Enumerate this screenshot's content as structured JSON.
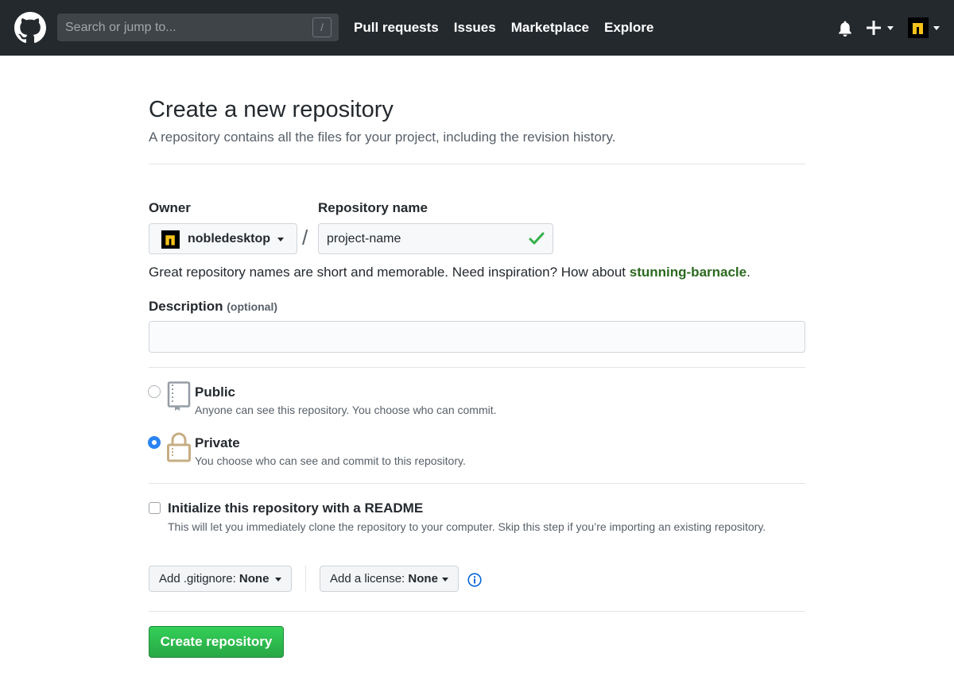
{
  "header": {
    "search_placeholder": "Search or jump to...",
    "search_shortcut": "/",
    "nav": [
      "Pull requests",
      "Issues",
      "Marketplace",
      "Explore"
    ]
  },
  "page": {
    "title": "Create a new repository",
    "subtitle": "A repository contains all the files for your project, including the revision history."
  },
  "form": {
    "owner_label": "Owner",
    "owner_value": "nobledesktop",
    "repo_label": "Repository name",
    "repo_value": "project-name",
    "slash": "/",
    "hint_prefix": "Great repository names are short and memorable. Need inspiration? How about ",
    "hint_suggestion": "stunning-barnacle",
    "hint_suffix": ".",
    "description_label": "Description",
    "description_optional": "(optional)",
    "description_value": "",
    "visibility": {
      "selected": "private",
      "public_title": "Public",
      "public_note": "Anyone can see this repository. You choose who can commit.",
      "private_title": "Private",
      "private_note": "You choose who can see and commit to this repository."
    },
    "readme": {
      "checked": false,
      "title": "Initialize this repository with a README",
      "note": "This will let you immediately clone the repository to your computer. Skip this step if you’re importing an existing repository."
    },
    "gitignore_prefix": "Add .gitignore: ",
    "gitignore_value": "None",
    "license_prefix": "Add a license: ",
    "license_value": "None",
    "submit_label": "Create repository"
  },
  "colors": {
    "header_bg": "#24292e",
    "primary_green": "#28a745",
    "radio_blue": "#2a83f2",
    "suggestion_green": "#2c6a1f"
  }
}
